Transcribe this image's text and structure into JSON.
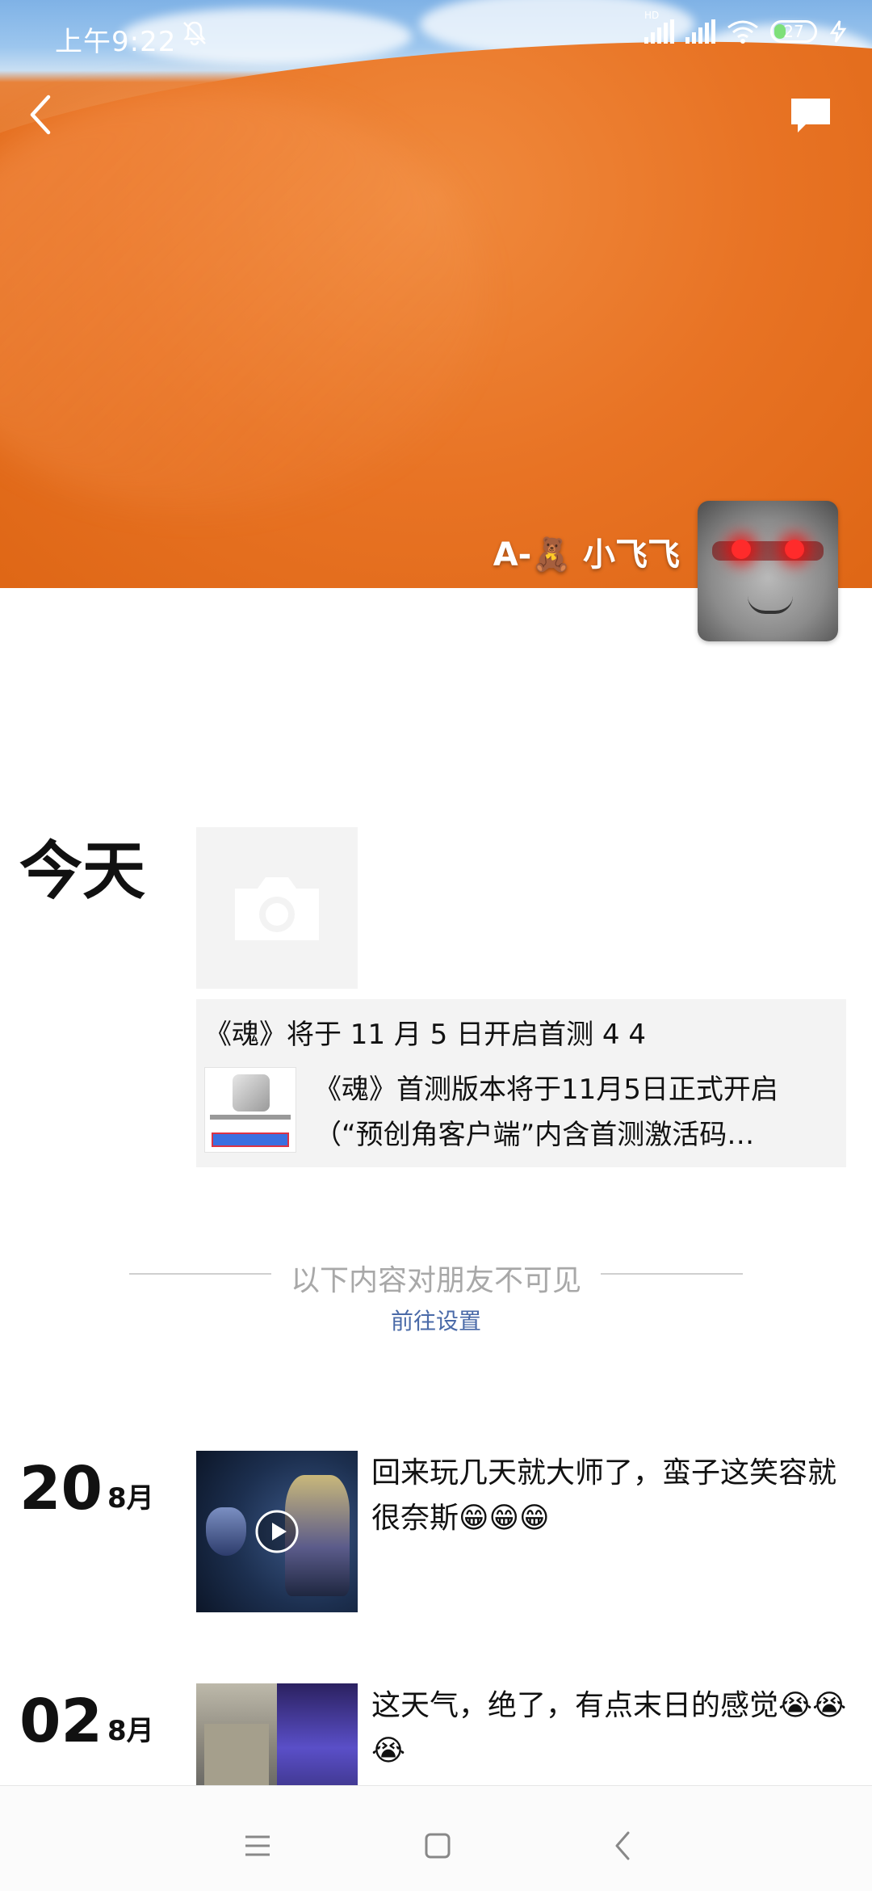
{
  "status_bar": {
    "time": "上午9:22",
    "network_label": "HD",
    "battery": "27"
  },
  "profile": {
    "name": "A-🧸 小飞飞"
  },
  "today": {
    "label": "今天",
    "share_card": {
      "title": "《魂》将于 11 月 5 日开启首测 4 4",
      "description": "《魂》首测版本将于11月5日正式开启（“预创角客户端”内含首测激活码…"
    }
  },
  "privacy_divider": {
    "text": "以下内容对朋友不可见",
    "settings_link": "前往设置"
  },
  "posts": [
    {
      "day": "20",
      "month": "8月",
      "text": "回来玩几天就大师了，蛮子这笑容就很奈斯😁😁😁"
    },
    {
      "day": "02",
      "month": "8月",
      "text": "这天气，绝了，有点末日的感觉😭😭😭"
    }
  ]
}
